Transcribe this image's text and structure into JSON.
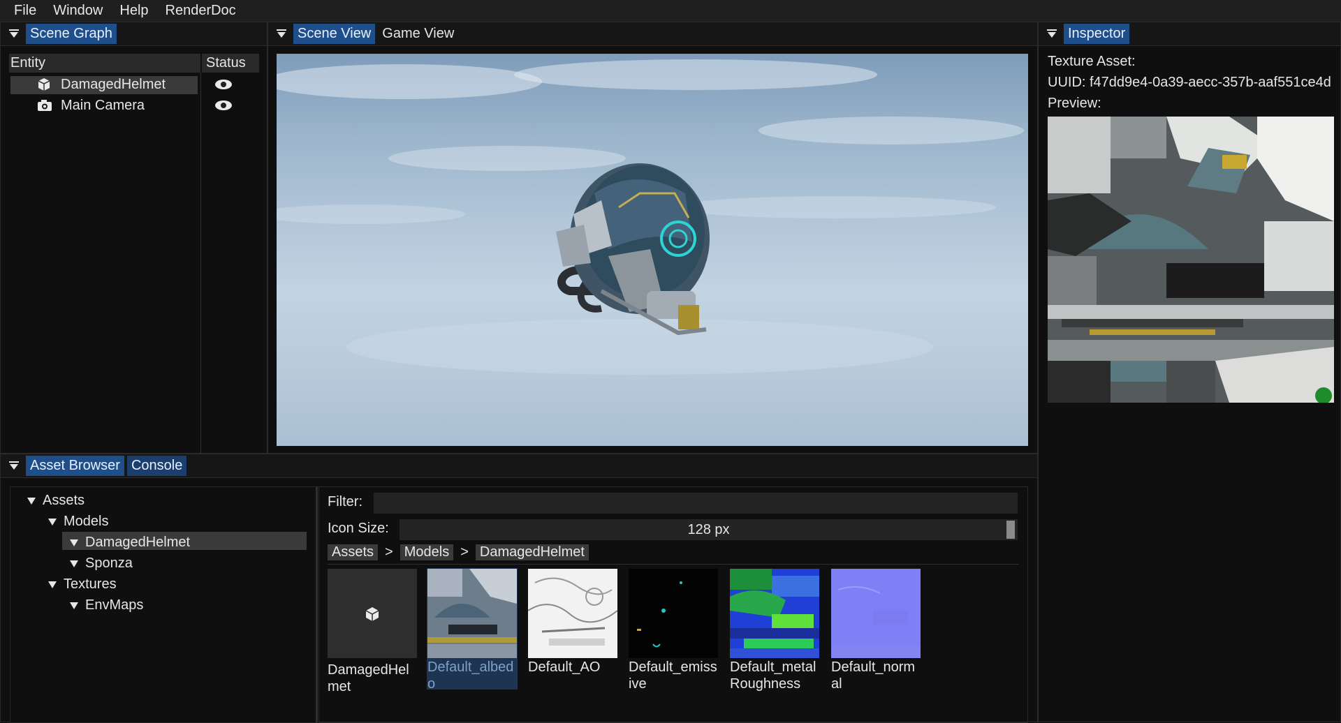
{
  "menu": [
    "File",
    "Window",
    "Help",
    "RenderDoc"
  ],
  "scene_graph": {
    "tab": "Scene Graph",
    "col_entity": "Entity",
    "col_status": "Status",
    "entities": [
      {
        "name": "DamagedHelmet",
        "icon": "cube-icon",
        "selected": true
      },
      {
        "name": "Main Camera",
        "icon": "camera-icon",
        "selected": false
      }
    ]
  },
  "viewport": {
    "tabs": [
      "Scene View",
      "Game View"
    ],
    "active_tab": "Scene View"
  },
  "inspector": {
    "tab": "Inspector",
    "type_label": "Texture Asset:",
    "uuid_label": "UUID: f47dd9e4-0a39-aecc-357b-aaf551ce4d",
    "preview_label": "Preview:"
  },
  "bottom": {
    "tabs": [
      "Asset Browser",
      "Console"
    ],
    "active_tab": "Asset Browser",
    "tree": [
      {
        "label": "Assets",
        "depth": 0
      },
      {
        "label": "Models",
        "depth": 1
      },
      {
        "label": "DamagedHelmet",
        "depth": 2,
        "selected": true
      },
      {
        "label": "Sponza",
        "depth": 2
      },
      {
        "label": "Textures",
        "depth": 1
      },
      {
        "label": "EnvMaps",
        "depth": 2
      }
    ],
    "filter_label": "Filter:",
    "filter_value": "",
    "icon_size_label": "Icon Size:",
    "icon_size_value": "128 px",
    "breadcrumb": [
      "Assets",
      ">",
      "Models",
      ">",
      "DamagedHelmet"
    ],
    "assets": [
      {
        "name": "DamagedHelmet",
        "kind": "model",
        "selected": false
      },
      {
        "name": "Default_albedo",
        "kind": "albedo",
        "selected": true
      },
      {
        "name": "Default_AO",
        "kind": "ao",
        "selected": false
      },
      {
        "name": "Default_emissive",
        "kind": "emissive",
        "selected": false
      },
      {
        "name": "Default_metalRoughness",
        "kind": "metal",
        "selected": false
      },
      {
        "name": "Default_normal",
        "kind": "normal",
        "selected": false
      }
    ]
  },
  "colors": {
    "accent": "#1e4f8a",
    "panel_bg": "#0f0f0f",
    "header_bg": "#161616"
  }
}
